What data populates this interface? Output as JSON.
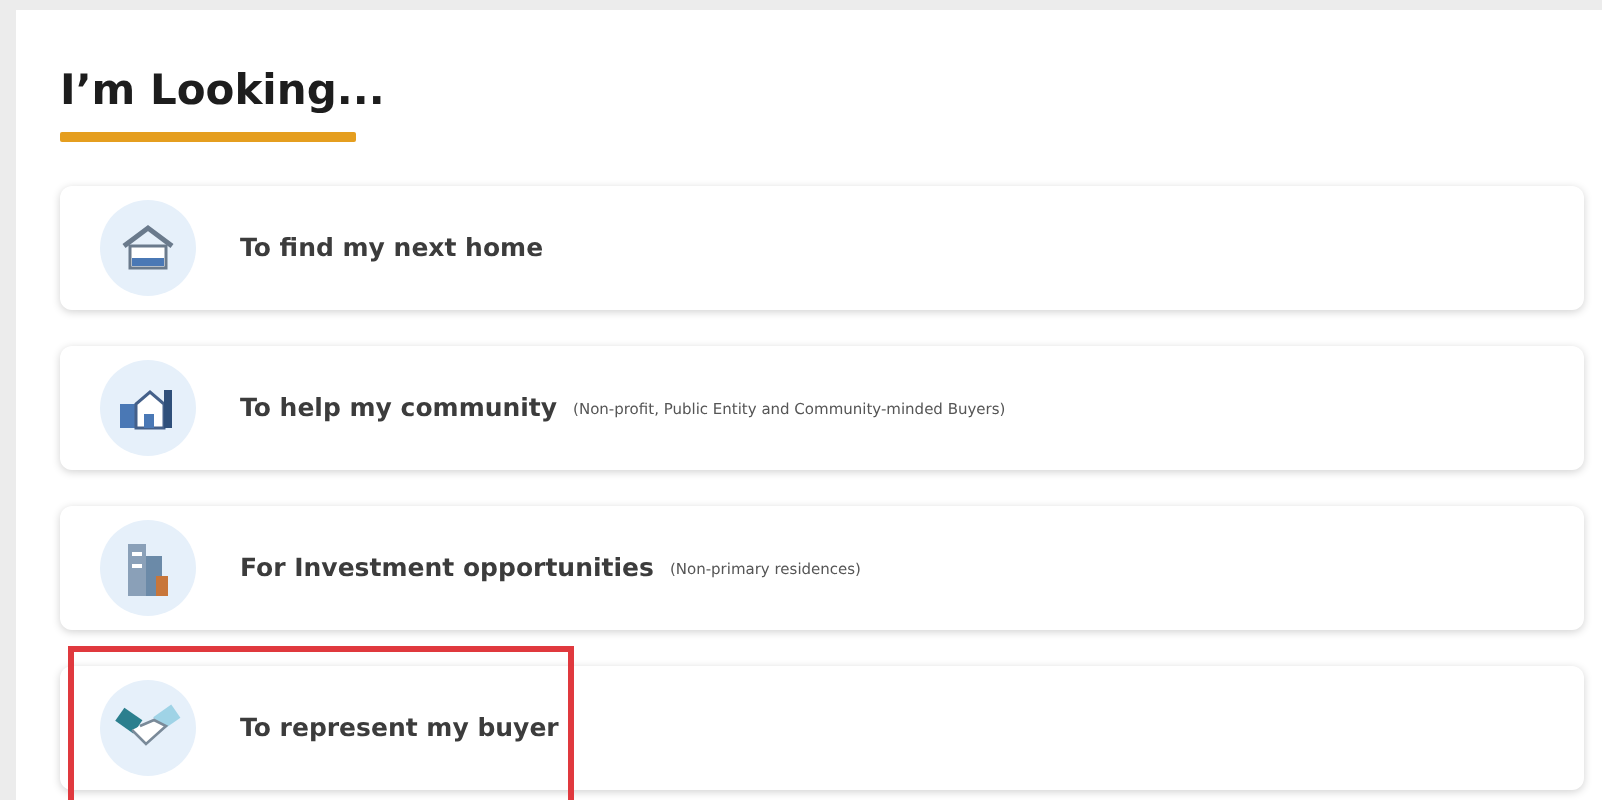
{
  "heading": "I’m Looking...",
  "options": [
    {
      "kind": "house",
      "label": "To find my next home",
      "highlighted": false
    },
    {
      "kind": "community",
      "label": "To help my community",
      "note": "(Non-profit, Public Entity and Community-minded Buyers)",
      "highlighted": false
    },
    {
      "kind": "buildings",
      "label": "For Investment opportunities",
      "note": "(Non-primary residences)",
      "highlighted": false
    },
    {
      "kind": "handshake",
      "label": "To represent my buyer",
      "highlighted": true
    }
  ]
}
